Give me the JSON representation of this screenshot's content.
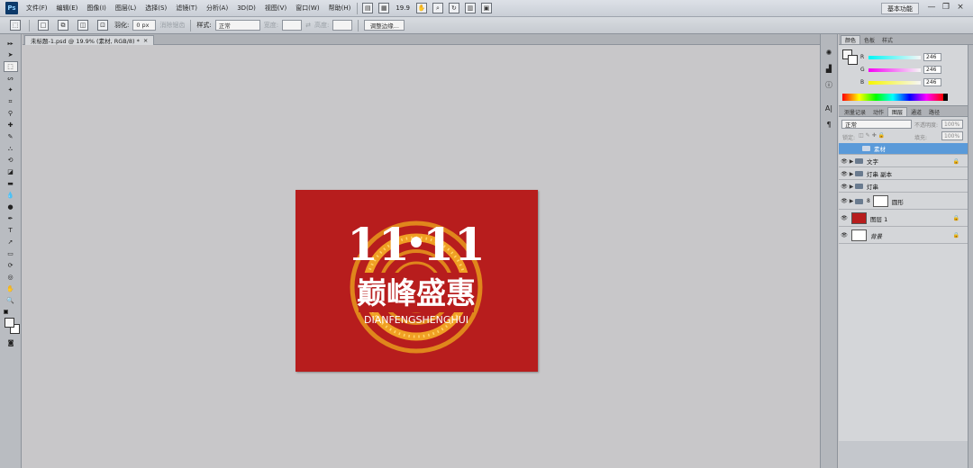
{
  "app": {
    "logo": "Ps"
  },
  "menu": [
    "文件(F)",
    "编辑(E)",
    "图像(I)",
    "图层(L)",
    "选择(S)",
    "滤镜(T)",
    "分析(A)",
    "3D(D)",
    "视图(V)",
    "窗口(W)",
    "帮助(H)"
  ],
  "menubar": {
    "zoom": "19.9",
    "workspace": "基本功能",
    "win_min": "—",
    "win_restore": "❐",
    "win_close": "×"
  },
  "options": {
    "feather_label": "羽化:",
    "feather_value": "0 px",
    "antialias_label": "消除锯齿",
    "style_label": "样式:",
    "style_value": "正常",
    "width_label": "宽度:",
    "height_label": "高度:",
    "refine_edge": "调整边缘..."
  },
  "document": {
    "tab_title": "未标题-1.psd @ 19.9% (素材, RGB/8) *",
    "close": "×"
  },
  "artwork": {
    "number_left": "11",
    "number_right": "11",
    "title_cn": "巅峰盛惠",
    "subtitle": "DIANFENGSHENGHUI",
    "bg_color": "#b71d1d",
    "ring_color": "#e0861c"
  },
  "color_panel": {
    "tabs": [
      "颜色",
      "色板",
      "样式"
    ],
    "sliders": [
      {
        "label": "R",
        "value": "246"
      },
      {
        "label": "G",
        "value": "246"
      },
      {
        "label": "B",
        "value": "246"
      }
    ]
  },
  "layers_panel": {
    "tabs": [
      "测量记录",
      "动作",
      "图层",
      "通道",
      "路径"
    ],
    "blend_mode": "正常",
    "opacity_label": "不透明度:",
    "opacity_value": "100%",
    "lock_label": "锁定:",
    "fill_label": "填充:",
    "fill_value": "100%",
    "layers": [
      {
        "name": "素材",
        "type": "group",
        "selected": true,
        "visible": false,
        "lock": ""
      },
      {
        "name": "文字",
        "type": "group",
        "selected": false,
        "visible": true,
        "lock": "🔒"
      },
      {
        "name": "灯串 副本",
        "type": "group",
        "selected": false,
        "visible": true,
        "lock": ""
      },
      {
        "name": "灯串",
        "type": "group",
        "selected": false,
        "visible": true,
        "lock": ""
      },
      {
        "name": "圆形",
        "type": "group-mask",
        "selected": false,
        "visible": true,
        "lock": ""
      },
      {
        "name": "图层 1",
        "type": "fill",
        "selected": false,
        "visible": true,
        "lock": "🔒",
        "color": "#b71d1d"
      },
      {
        "name": "背景",
        "type": "fill",
        "selected": false,
        "visible": true,
        "lock": "🔒",
        "color": "#ffffff"
      }
    ]
  }
}
